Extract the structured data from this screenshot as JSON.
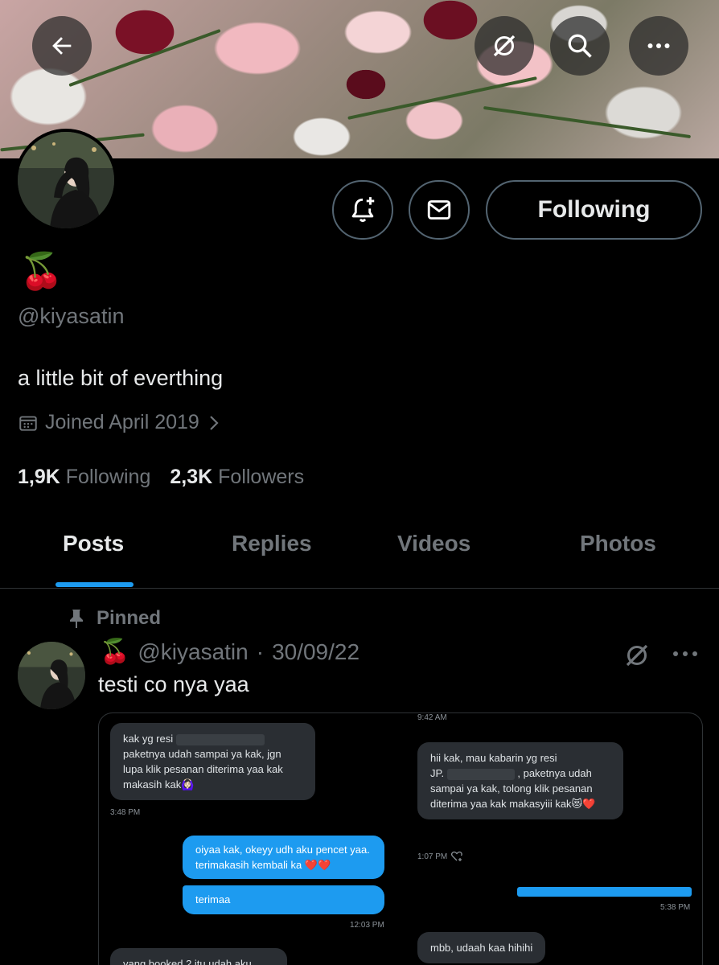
{
  "profile": {
    "emoji": "🍒",
    "handle": "@kiyasatin",
    "bio": "a little bit of everthing",
    "joined": "Joined April 2019",
    "following_count": "1,9K",
    "following_label": "Following",
    "followers_count": "2,3K",
    "followers_label": "Followers",
    "follow_button": "Following"
  },
  "tabs": [
    {
      "label": "Posts"
    },
    {
      "label": "Replies"
    },
    {
      "label": "Videos"
    },
    {
      "label": "Photos"
    }
  ],
  "post": {
    "pinned_label": "Pinned",
    "emoji": "🍒",
    "handle": "@kiyasatin",
    "separator": "·",
    "date": "30/09/22",
    "text": "testi co nya yaa"
  },
  "chat_image": {
    "left_msg_1_line1": "kak yg resi",
    "left_msg_1_rest": "paketnya udah sampai ya kak, jgn lupa klik pesanan diterima yaa kak makasih kak🙆🏻‍♀️",
    "left_ts_1": "3:48 PM",
    "right_top_ts": "9:42 AM",
    "right_msg_1_line1": "hii kak, mau kabarin yg resi",
    "right_msg_1_line2_prefix": "JP.",
    "right_msg_1_line2_suffix": ", paketnya udah",
    "right_msg_1_rest": "sampai ya kak, tolong klik pesanan diterima yaa kak makasyiii kak😻❤️",
    "right_ts_1": "1:07 PM",
    "out_msg_1": "oiyaa kak, okeyy udh aku pencet yaa. terimakasih kembali ka ❤️❤️",
    "out_msg_2": "terimaa",
    "left_ts_2": "12:03 PM",
    "right_ts_2": "5:38 PM",
    "right_msg_2": "mbb, udaah kaa hihihi",
    "left_msg_2": "yang booked 2 itu udah aku"
  },
  "colors": {
    "accent": "#1d9bf0",
    "muted": "#71767b",
    "background": "#000000"
  }
}
